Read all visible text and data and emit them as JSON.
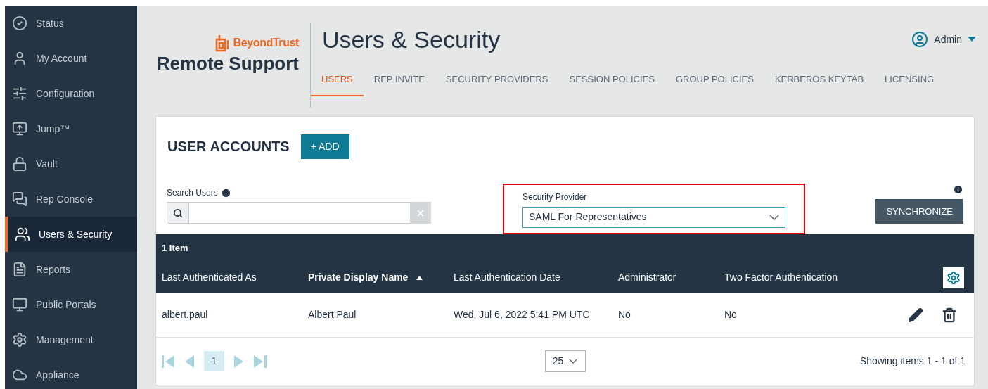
{
  "sidebar": {
    "items": [
      {
        "label": "Status",
        "selected": false
      },
      {
        "label": "My Account",
        "selected": false
      },
      {
        "label": "Configuration",
        "selected": false
      },
      {
        "label": "Jump™",
        "selected": false
      },
      {
        "label": "Vault",
        "selected": false
      },
      {
        "label": "Rep Console",
        "selected": false
      },
      {
        "label": "Users & Security",
        "selected": true
      },
      {
        "label": "Reports",
        "selected": false
      },
      {
        "label": "Public Portals",
        "selected": false
      },
      {
        "label": "Management",
        "selected": false
      },
      {
        "label": "Appliance",
        "selected": false
      }
    ]
  },
  "brand": {
    "company": "BeyondTrust",
    "product": "Remote Support"
  },
  "page": {
    "title": "Users & Security"
  },
  "user_menu": {
    "label": "Admin"
  },
  "tabs": [
    {
      "label": "USERS",
      "selected": true
    },
    {
      "label": "REP INVITE",
      "selected": false
    },
    {
      "label": "SECURITY PROVIDERS",
      "selected": false
    },
    {
      "label": "SESSION POLICIES",
      "selected": false
    },
    {
      "label": "GROUP POLICIES",
      "selected": false
    },
    {
      "label": "KERBEROS KEYTAB",
      "selected": false
    },
    {
      "label": "LICENSING",
      "selected": false
    }
  ],
  "section": {
    "title": "USER ACCOUNTS",
    "add_button": "+ ADD"
  },
  "search": {
    "label": "Search Users"
  },
  "security_provider": {
    "label": "Security Provider",
    "value": "SAML For Representatives",
    "highlighted": true
  },
  "sync_button": "SYNCHRONIZE",
  "table": {
    "count": "1 Item",
    "columns": [
      {
        "label": "Last Authenticated As",
        "sorted": false
      },
      {
        "label": "Private Display Name",
        "sorted": true
      },
      {
        "label": "Last Authentication Date",
        "sorted": false
      },
      {
        "label": "Administrator",
        "sorted": false
      },
      {
        "label": "Two Factor Authentication",
        "sorted": false
      }
    ],
    "rows": [
      {
        "cells": [
          "albert.paul",
          "Albert Paul",
          "Wed, Jul 6, 2022 5:41 PM UTC",
          "No",
          "No"
        ]
      }
    ]
  },
  "pager": {
    "pages": [
      {
        "label": "1",
        "selected": true
      }
    ],
    "page_size": "25",
    "summary": "Showing items 1 - 1 of 1"
  }
}
